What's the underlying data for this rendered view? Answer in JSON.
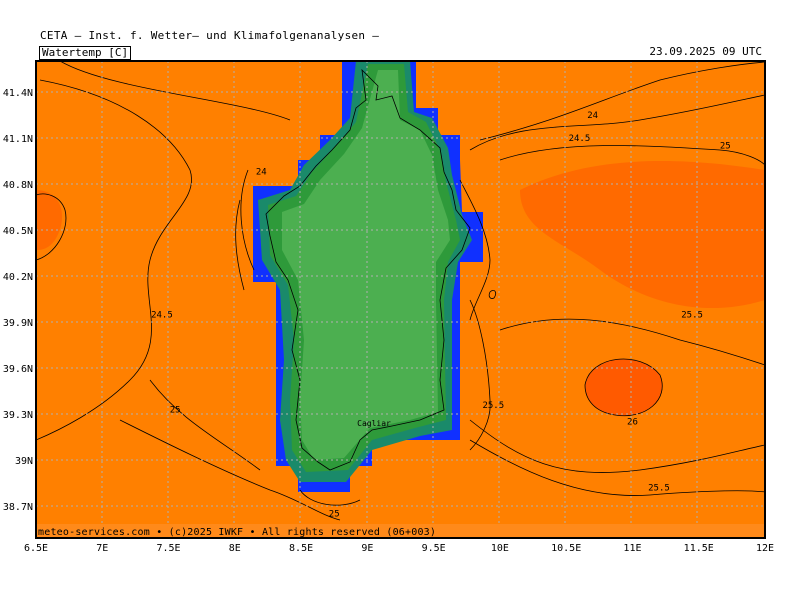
{
  "header": {
    "institute": "CETA – Inst. f. Wetter– und Klimafolgenanalysen –"
  },
  "panel": {
    "variable": "Watertemp [C]",
    "valid_time": "23.09.2025 09 UTC"
  },
  "footer": {
    "credit": "meteo-services.com • (c)2025 IWKF • All rights reserved (06+003)"
  },
  "axes": {
    "lon_ticks": [
      "6.5E",
      "7E",
      "7.5E",
      "8E",
      "8.5E",
      "9E",
      "9.5E",
      "10E",
      "10.5E",
      "11E",
      "11.5E",
      "12E"
    ],
    "lat_ticks": [
      "41.4N",
      "41.1N",
      "40.8N",
      "40.5N",
      "40.2N",
      "39.9N",
      "39.6N",
      "39.3N",
      "39N",
      "38.7N"
    ]
  },
  "contour_labels": [
    {
      "text": "24",
      "lon": 10.7,
      "lat": 41.25
    },
    {
      "text": "24.5",
      "lon": 10.6,
      "lat": 41.1
    },
    {
      "text": "25",
      "lon": 11.7,
      "lat": 41.05
    },
    {
      "text": "24",
      "lon": 8.2,
      "lat": 40.88
    },
    {
      "text": "24.5",
      "lon": 7.45,
      "lat": 39.95
    },
    {
      "text": "25",
      "lon": 7.55,
      "lat": 39.33
    },
    {
      "text": "25.5",
      "lon": 11.45,
      "lat": 39.95
    },
    {
      "text": "25.5",
      "lon": 9.95,
      "lat": 39.36
    },
    {
      "text": "26",
      "lon": 11.0,
      "lat": 39.25
    },
    {
      "text": "25.5",
      "lon": 11.2,
      "lat": 38.82
    },
    {
      "text": "25",
      "lon": 8.75,
      "lat": 38.65
    },
    {
      "text": "Cagliar",
      "lon": 9.05,
      "lat": 39.24
    }
  ],
  "colors": {
    "sea": "#ff8000",
    "sea_warm": "#ff6a00",
    "land_green": "#4caf50",
    "land_dark": "#2e9a3a",
    "teal": "#1a8a6a",
    "blue": "#1030ff"
  }
}
